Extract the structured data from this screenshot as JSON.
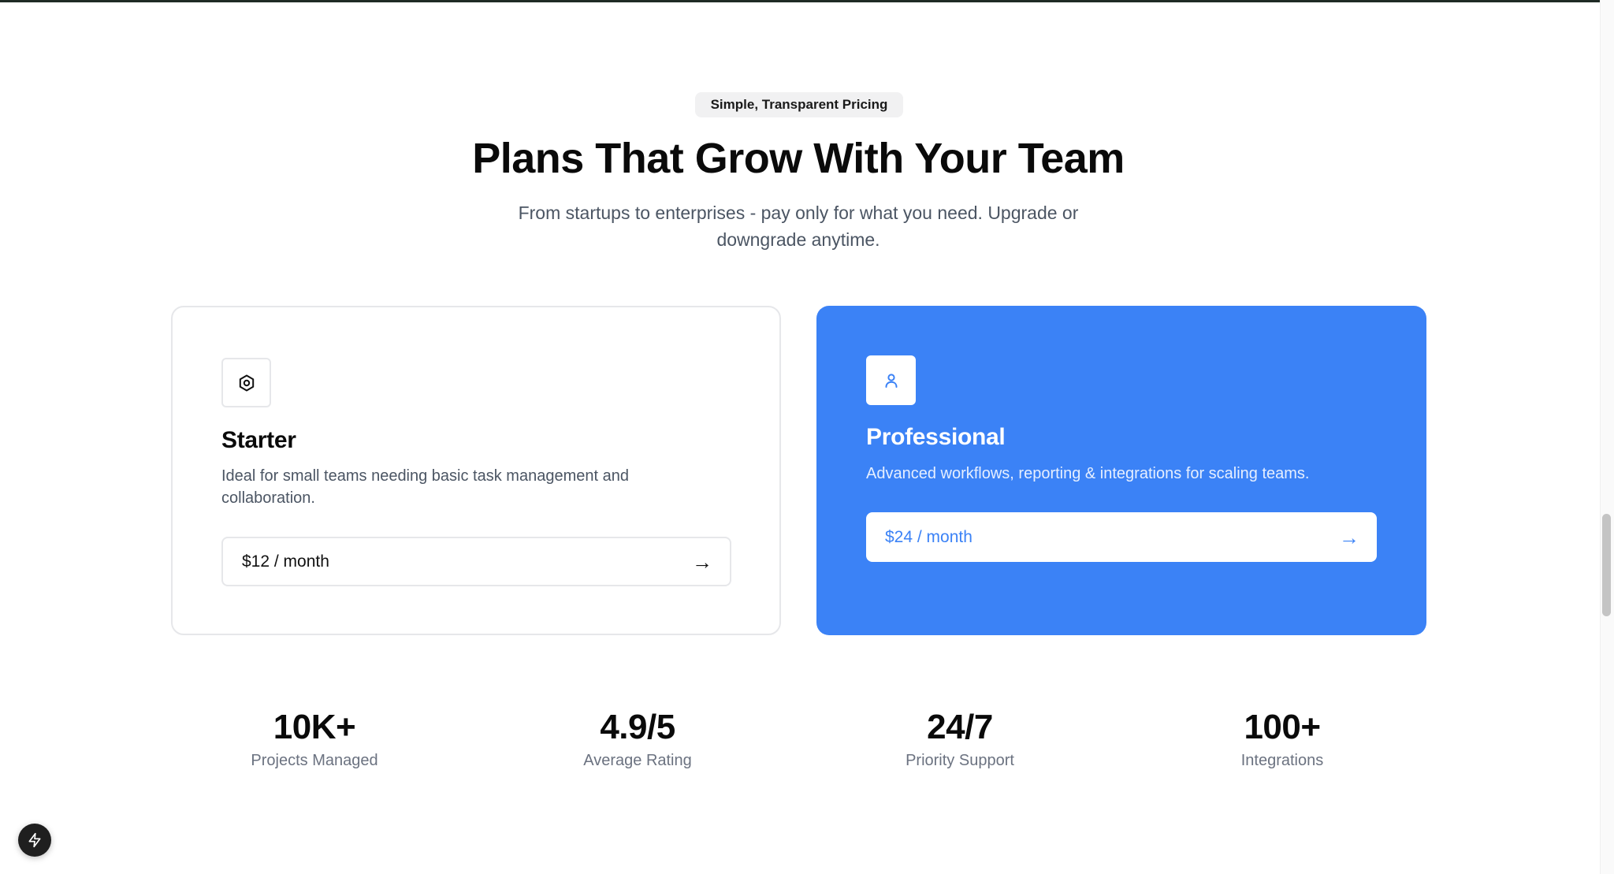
{
  "hero": {
    "badge": "Simple, Transparent Pricing",
    "title": "Plans That Grow With Your Team",
    "subtitle": "From startups to enterprises - pay only for what you need. Upgrade or downgrade anytime."
  },
  "plans": [
    {
      "icon": "hexagon-settings-icon",
      "name": "Starter",
      "description": "Ideal for small teams needing basic task management and collaboration.",
      "price_label": "$12 / month",
      "arrow": "→"
    },
    {
      "icon": "user-icon",
      "name": "Professional",
      "description": "Advanced workflows, reporting & integrations for scaling teams.",
      "price_label": "$24 / month",
      "arrow": "→"
    }
  ],
  "stats": [
    {
      "value": "10K+",
      "label": "Projects Managed"
    },
    {
      "value": "4.9/5",
      "label": "Average Rating"
    },
    {
      "value": "24/7",
      "label": "Priority Support"
    },
    {
      "value": "100+",
      "label": "Integrations"
    }
  ],
  "colors": {
    "accent": "#3b82f6",
    "text": "#0a0a0a",
    "muted": "#4b5563",
    "border": "#e6e7ea"
  },
  "fab": {
    "icon": "lightning-icon"
  }
}
